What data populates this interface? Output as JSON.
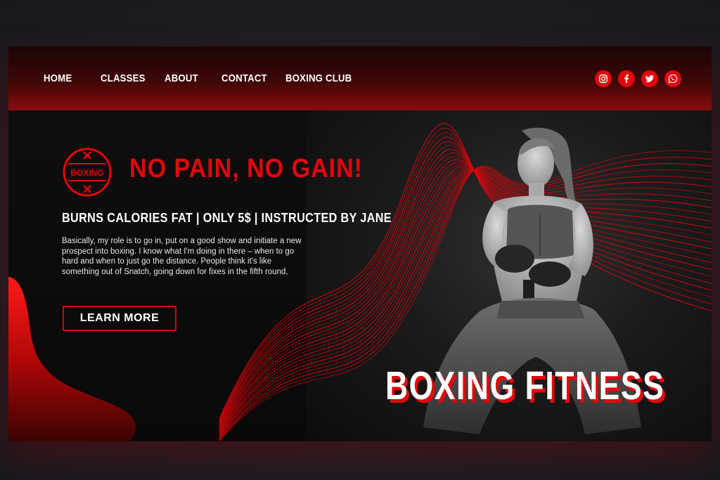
{
  "nav": {
    "items": [
      {
        "label": "HOME"
      },
      {
        "label": "CLASSES"
      },
      {
        "label": "ABOUT"
      },
      {
        "label": "CONTACT"
      },
      {
        "label": "BOXING CLUB"
      }
    ]
  },
  "socials": [
    {
      "icon": "instagram-icon"
    },
    {
      "icon": "facebook-icon"
    },
    {
      "icon": "twitter-icon"
    },
    {
      "icon": "whatsapp-icon"
    }
  ],
  "hero": {
    "badge_text": "BOXING",
    "headline": "NO PAIN, NO GAIN!",
    "subline": "BURNS CALORIES FAT | ONLY 5$ | INSTRUCTED BY JANE",
    "body": "Basically, my role is to go in, put on a good show and initiate a new prospect into boxing. I know what I'm doing in there – when to go hard and when to just go the distance. People think it's like something out of Snatch, going down for fixes in the fifth round,",
    "cta_label": "LEARN MORE",
    "title": "BOXING FITNESS"
  },
  "colors": {
    "accent": "#e3060b",
    "background": "#0b0b0c",
    "text": "#ffffff"
  }
}
